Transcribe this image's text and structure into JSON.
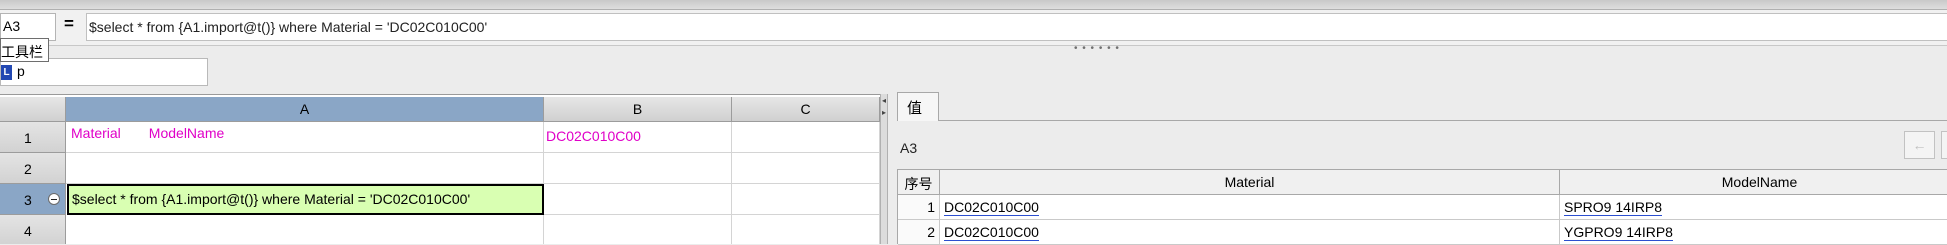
{
  "formula_bar": {
    "cell_ref": "A3",
    "equals": "=",
    "formula": "$select * from {A1.import@t()} where Material = 'DC02C010C00'"
  },
  "tooltip": "工具栏",
  "find": {
    "value": "p"
  },
  "grid": {
    "columns": [
      "A",
      "B",
      "C"
    ],
    "rows": [
      {
        "num": "1",
        "a1": "Material",
        "a2": "ModelName",
        "b": "DC02C010C00",
        "c": ""
      },
      {
        "num": "2",
        "a1": "",
        "a2": "",
        "b": "",
        "c": ""
      },
      {
        "num": "3",
        "a1": "$select * from {A1.import@t()} where Material = 'DC02C010C00'",
        "a2": "",
        "b": "",
        "c": ""
      },
      {
        "num": "4",
        "a1": "",
        "a2": "",
        "b": "",
        "c": ""
      }
    ]
  },
  "value_panel": {
    "tab_label": "值",
    "cell_name": "A3",
    "nav_back": "←",
    "table": {
      "headers": [
        "序号",
        "Material",
        "ModelName"
      ],
      "rows": [
        {
          "idx": "1",
          "material": "DC02C010C00",
          "model": "SPRO9 14IRP8"
        },
        {
          "idx": "2",
          "material": "DC02C010C00",
          "model": "YGPRO9 14IRP8"
        }
      ]
    }
  },
  "colors": {
    "accent_magenta": "#e000c8",
    "selected_header": "#8aa6c6",
    "active_cell_bg": "#d9ffb2",
    "link_underline": "#2c4fd0"
  }
}
